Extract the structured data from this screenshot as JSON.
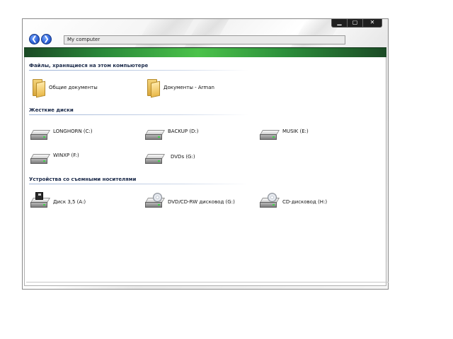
{
  "window": {
    "controls": {
      "minimize": "▁",
      "maximize": "▢",
      "close": "✕"
    }
  },
  "nav": {
    "back_icon": "❮",
    "forward_icon": "❯"
  },
  "address": {
    "value": "My computer"
  },
  "sections": {
    "stored": {
      "title": "Файлы, хранящиеся на этом компьютере",
      "items": [
        {
          "label": "Общие документы",
          "icon": "folder-icon"
        },
        {
          "label": "Документы - Arman",
          "icon": "folder-icon"
        }
      ]
    },
    "hdd": {
      "title": "Жесткие диски",
      "items": [
        {
          "label": "LONGHORN (C:)",
          "icon": "hard-drive-icon"
        },
        {
          "label": "BACKUP (D:)",
          "icon": "hard-drive-icon"
        },
        {
          "label": "MUSIK (E:)",
          "icon": "hard-drive-icon"
        },
        {
          "label": "WINXP (F:)",
          "icon": "hard-drive-icon"
        },
        {
          "label": "DVDs   (G:)",
          "icon": "hard-drive-icon"
        }
      ]
    },
    "removable": {
      "title": "Устройства со съемными носителями",
      "items": [
        {
          "label": "Диск 3,5 (A:)",
          "icon": "floppy-drive-icon"
        },
        {
          "label": "DVD/CD-RW дисковод (G:)",
          "icon": "dvd-drive-icon"
        },
        {
          "label": "CD-дисковод (H:)",
          "icon": "cd-drive-icon"
        }
      ]
    }
  }
}
